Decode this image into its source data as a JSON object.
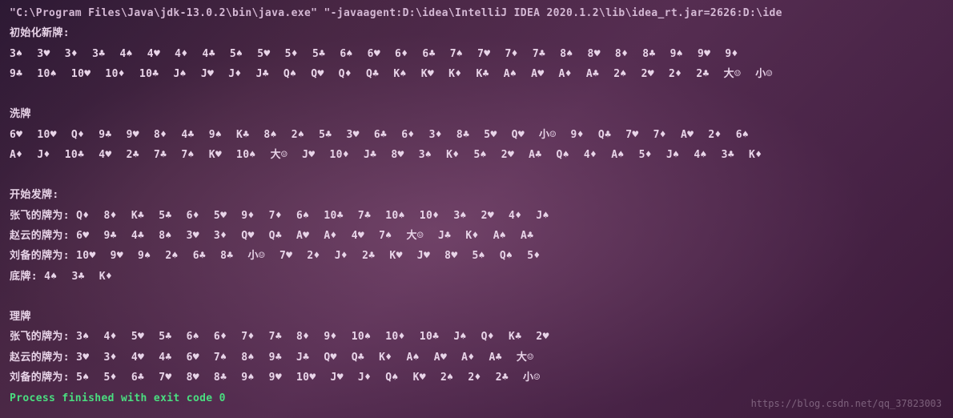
{
  "cmd": "\"C:\\Program Files\\Java\\jdk-13.0.2\\bin\\java.exe\" \"-javaagent:D:\\idea\\IntelliJ IDEA 2020.1.2\\lib\\idea_rt.jar=2626:D:\\ide",
  "init_label": "初始化新牌:",
  "init_row1": [
    "3♠",
    "3♥",
    "3♦",
    "3♣",
    "4♠",
    "4♥",
    "4♦",
    "4♣",
    "5♠",
    "5♥",
    "5♦",
    "5♣",
    "6♠",
    "6♥",
    "6♦",
    "6♣",
    "7♠",
    "7♥",
    "7♦",
    "7♣",
    "8♠",
    "8♥",
    "8♦",
    "8♣",
    "9♠",
    "9♥",
    "9♦"
  ],
  "init_row2": [
    "9♣",
    "10♠",
    "10♥",
    "10♦",
    "10♣",
    "J♠",
    "J♥",
    "J♦",
    "J♣",
    "Q♠",
    "Q♥",
    "Q♦",
    "Q♣",
    "K♠",
    "K♥",
    "K♦",
    "K♣",
    "A♠",
    "A♥",
    "A♦",
    "A♣",
    "2♠",
    "2♥",
    "2♦",
    "2♣",
    "大☺",
    "小☺"
  ],
  "shuffle_label": "洗牌",
  "shuffle_row1": [
    "6♥",
    "10♥",
    "Q♦",
    "9♣",
    "9♥",
    "8♦",
    "4♣",
    "9♠",
    "K♣",
    "8♠",
    "2♠",
    "5♣",
    "3♥",
    "6♣",
    "6♦",
    "3♦",
    "8♣",
    "5♥",
    "Q♥",
    "小☺",
    "9♦",
    "Q♣",
    "7♥",
    "7♦",
    "A♥",
    "2♦",
    "6♠"
  ],
  "shuffle_row2": [
    "A♦",
    "J♦",
    "10♣",
    "4♥",
    "2♣",
    "7♣",
    "7♠",
    "K♥",
    "10♠",
    "大☺",
    "J♥",
    "10♦",
    "J♣",
    "8♥",
    "3♠",
    "K♦",
    "5♠",
    "2♥",
    "A♣",
    "Q♠",
    "4♦",
    "A♠",
    "5♦",
    "J♠",
    "4♠",
    "3♣",
    "K♦"
  ],
  "deal_label": "开始发牌:",
  "zhangfei_label": "张飞的牌为:",
  "zhangfei_cards": [
    "Q♦",
    "8♦",
    "K♣",
    "5♣",
    "6♦",
    "5♥",
    "9♦",
    "7♦",
    "6♠",
    "10♣",
    "7♣",
    "10♠",
    "10♦",
    "3♠",
    "2♥",
    "4♦",
    "J♠"
  ],
  "zhaoyun_label": "赵云的牌为:",
  "zhaoyun_cards": [
    "6♥",
    "9♣",
    "4♣",
    "8♠",
    "3♥",
    "3♦",
    "Q♥",
    "Q♣",
    "A♥",
    "A♦",
    "4♥",
    "7♠",
    "大☺",
    "J♣",
    "K♦",
    "A♠",
    "A♣"
  ],
  "liubei_label": "刘备的牌为:",
  "liubei_cards": [
    "10♥",
    "9♥",
    "9♠",
    "2♠",
    "6♣",
    "8♣",
    "小☺",
    "7♥",
    "2♦",
    "J♦",
    "2♣",
    "K♥",
    "J♥",
    "8♥",
    "5♠",
    "Q♠",
    "5♦"
  ],
  "dipai_label": "底牌:",
  "dipai_cards": [
    "4♠",
    "3♣",
    "K♦"
  ],
  "sort_label": "理牌",
  "zhangfei_sorted": [
    "3♠",
    "4♦",
    "5♥",
    "5♣",
    "6♠",
    "6♦",
    "7♦",
    "7♣",
    "8♦",
    "9♦",
    "10♠",
    "10♦",
    "10♣",
    "J♠",
    "Q♦",
    "K♣",
    "2♥"
  ],
  "zhaoyun_sorted": [
    "3♥",
    "3♦",
    "4♥",
    "4♣",
    "6♥",
    "7♠",
    "8♠",
    "9♣",
    "J♣",
    "Q♥",
    "Q♣",
    "K♦",
    "A♠",
    "A♥",
    "A♦",
    "A♣",
    "大☺"
  ],
  "liubei_sorted": [
    "5♠",
    "5♦",
    "6♣",
    "7♥",
    "8♥",
    "8♣",
    "9♠",
    "9♥",
    "10♥",
    "J♥",
    "J♦",
    "Q♠",
    "K♥",
    "2♠",
    "2♦",
    "2♣",
    "小☺"
  ],
  "exit_msg": "Process finished with exit code 0",
  "watermark": "https://blog.csdn.net/qq_37823003"
}
